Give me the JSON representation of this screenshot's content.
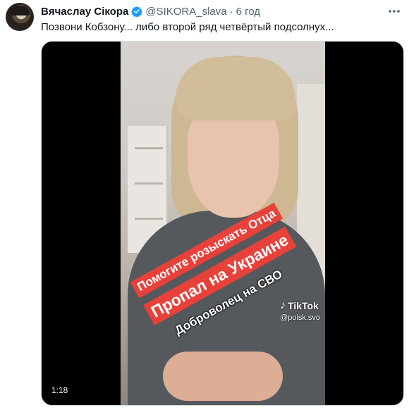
{
  "tweet": {
    "author_name": "Вячаслау Сікора",
    "handle": "@SIKORA_slava",
    "separator": "·",
    "time": "6 год",
    "text": "Позвони Кобзону... либо второй ряд четвёртый подсолнух...",
    "more_icon": "more-horizontal-icon",
    "verified_icon": "verified-badge-icon",
    "verified_color": "#1d9bf0"
  },
  "media": {
    "duration": "1:18",
    "caption_line1": "Помогите розыскать Отца",
    "caption_line2": "Пропал на Украине",
    "caption_line3": "Доброволец на СВО",
    "caption_bg_color": "#e8413a",
    "watermark_brand": "TikTok",
    "watermark_user": "@poisk.svo"
  }
}
